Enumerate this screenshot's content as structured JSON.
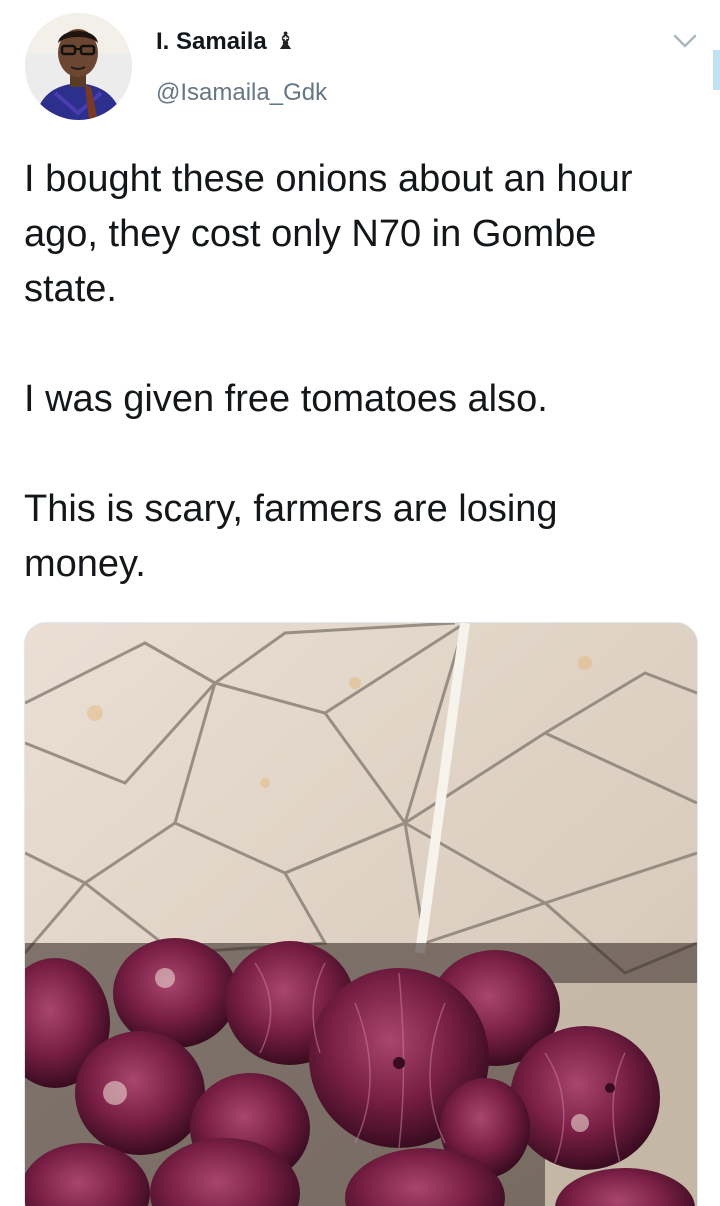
{
  "tweet": {
    "author": {
      "display_name": "I. Samaila",
      "name_emoji": "♝",
      "handle": "@Isamaila_Gdk"
    },
    "text_paragraphs": [
      "I bought these onions about an hour ago, they cost only N70 in Gombe state.",
      "I was given free tomatoes also.",
      "This is scary, farmers are losing money."
    ],
    "menu_icon": "chevron-down-icon",
    "colors": {
      "text": "#14171a",
      "secondary_text": "#657786",
      "chevron": "#aab8c2"
    }
  }
}
